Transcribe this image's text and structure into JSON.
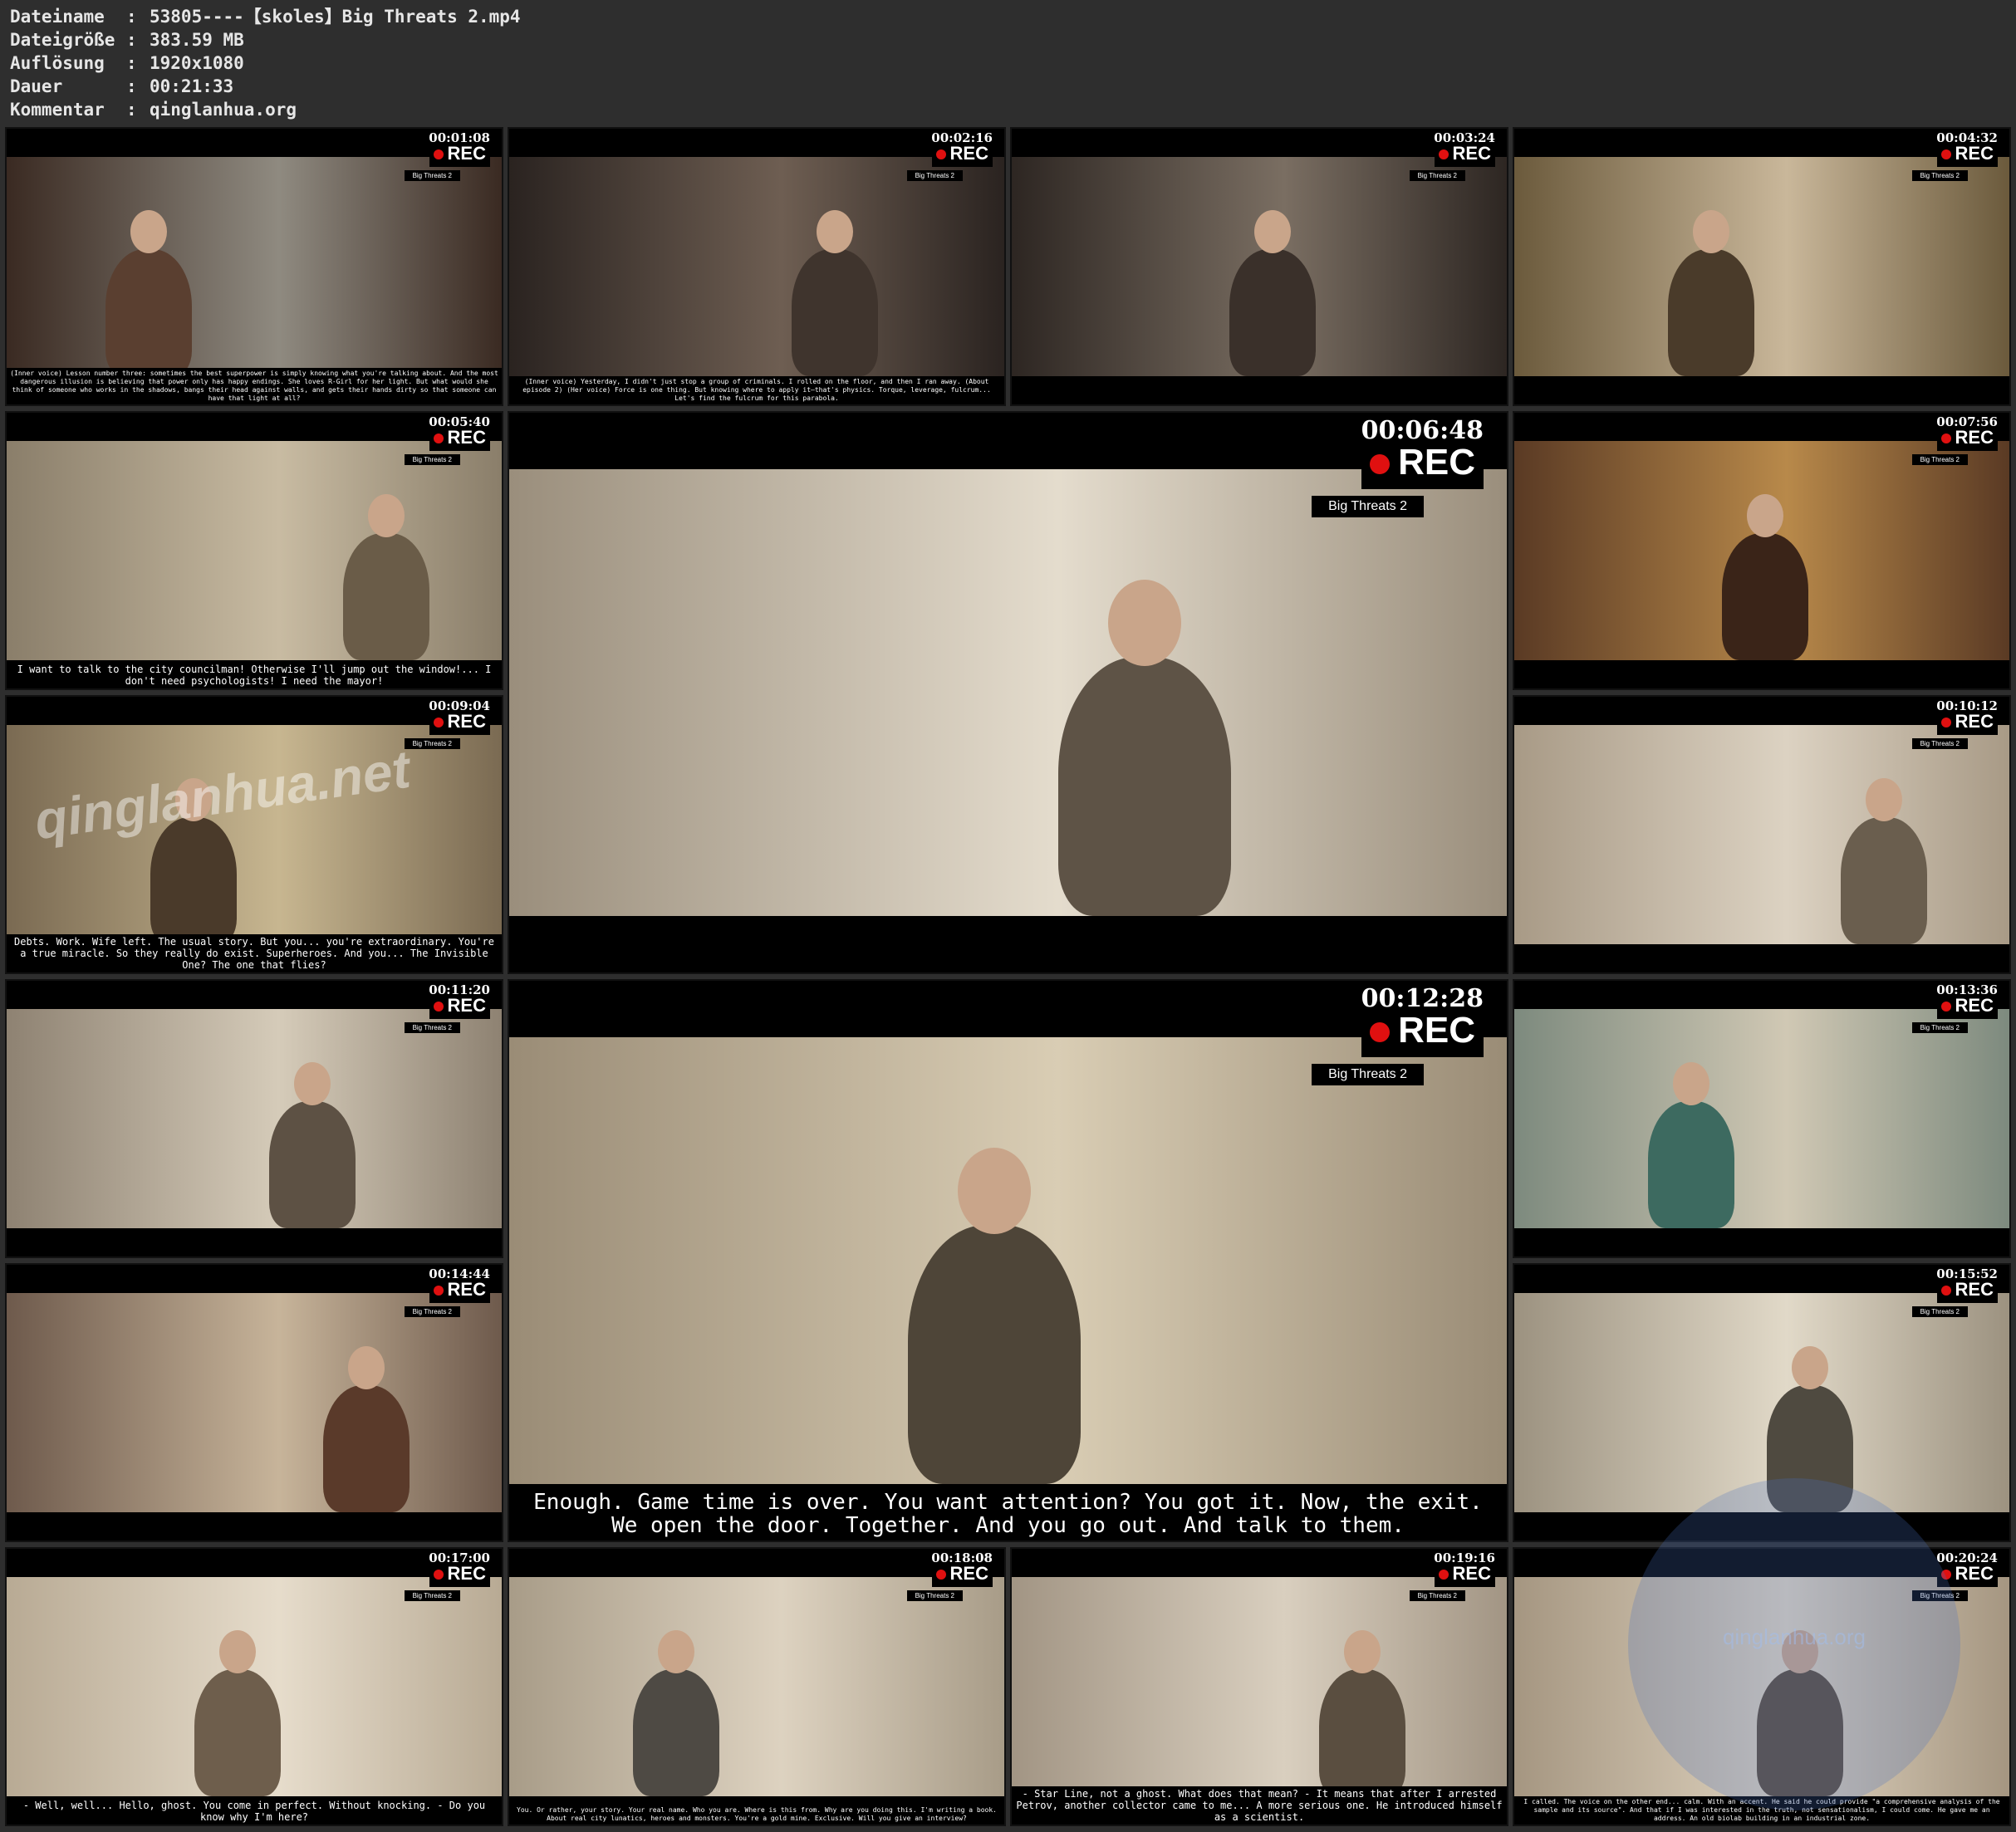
{
  "info": [
    {
      "key": "Dateiname",
      "value": "53805----【skoles】Big Threats 2.mp4"
    },
    {
      "key": "Dateigröße",
      "value": "383.59 MB"
    },
    {
      "key": "Auflösung",
      "value": "1920x1080"
    },
    {
      "key": "Dauer",
      "value": "00:21:33"
    },
    {
      "key": "Kommentar",
      "value": "qinglanhua.org"
    }
  ],
  "rec_label": "REC",
  "tag_label": "Big Threats 2",
  "thumbnails": [
    {
      "time": "00:01:08",
      "subtitle": "(Inner voice) Lesson number three: sometimes the best superpower is simply knowing what you're talking about. And the most dangerous illusion is believing that power only has happy endings. She loves R-Girl for her light. But what would she think of someone who works in the shadows, bangs their head against walls, and gets their hands dirty so that someone can have that light at all?"
    },
    {
      "time": "00:02:16",
      "subtitle": "(Inner voice) Yesterday, I didn't just stop a group of criminals. I rolled on the floor, and then I ran away. (About episode 2) (Her voice) Force is one thing. But knowing where to apply it—that's physics. Torque, leverage, fulcrum... Let's find the fulcrum for this parabola."
    },
    {
      "time": "00:03:24",
      "subtitle": ""
    },
    {
      "time": "00:04:32",
      "subtitle": ""
    },
    {
      "time": "00:05:40",
      "subtitle": "I want to talk to the city councilman! Otherwise I'll jump out the window!... I don't need psychologists! I need the mayor!"
    },
    {
      "time": "00:06:48",
      "subtitle": ""
    },
    {
      "time": "00:07:56",
      "subtitle": ""
    },
    {
      "time": "00:09:04",
      "subtitle": "Debts. Work. Wife left. The usual story. But you... you're extraordinary. You're a true miracle. So they really do exist. Superheroes. And you... The Invisible One? The one that flies?"
    },
    {
      "time": "00:10:12",
      "subtitle": ""
    },
    {
      "time": "00:11:20",
      "subtitle": ""
    },
    {
      "time": "00:12:28",
      "subtitle": "Enough. Game time is over. You want attention? You got it. Now, the exit. We open the door. Together. And you go out. And talk to them."
    },
    {
      "time": "00:13:36",
      "subtitle": ""
    },
    {
      "time": "00:14:44",
      "subtitle": ""
    },
    {
      "time": "00:15:52",
      "subtitle": ""
    },
    {
      "time": "00:17:00",
      "subtitle": "- Well, well... Hello, ghost. You come in perfect. Without knocking. - Do you know why I'm here?"
    },
    {
      "time": "00:18:08",
      "subtitle": "You. Or rather, your story. Your real name. Who you are. Where is this from. Why are you doing this. I'm writing a book. About real city lunatics, heroes and monsters. You're a gold mine. Exclusive. Will you give an interview?"
    },
    {
      "time": "00:19:16",
      "subtitle": "- Star Line, not a ghost. What does that mean? - It means that after I arrested Petrov, another collector came to me... A more serious one. He introduced himself as a scientist."
    },
    {
      "time": "00:20:24",
      "subtitle": "I called. The voice on the other end... calm. With an accent. He said he could provide \"a comprehensive analysis of the sample and its source\". And that if I was interested in the truth, not sensationalism, I could come. He gave me an address. An old biolab building in an industrial zone."
    }
  ],
  "watermark_text": "qinglanhua.net",
  "corner_watermark_text": "qinglanhua.org",
  "colors": {
    "background": "#2e2e2e",
    "rec_dot": "#e01010"
  }
}
